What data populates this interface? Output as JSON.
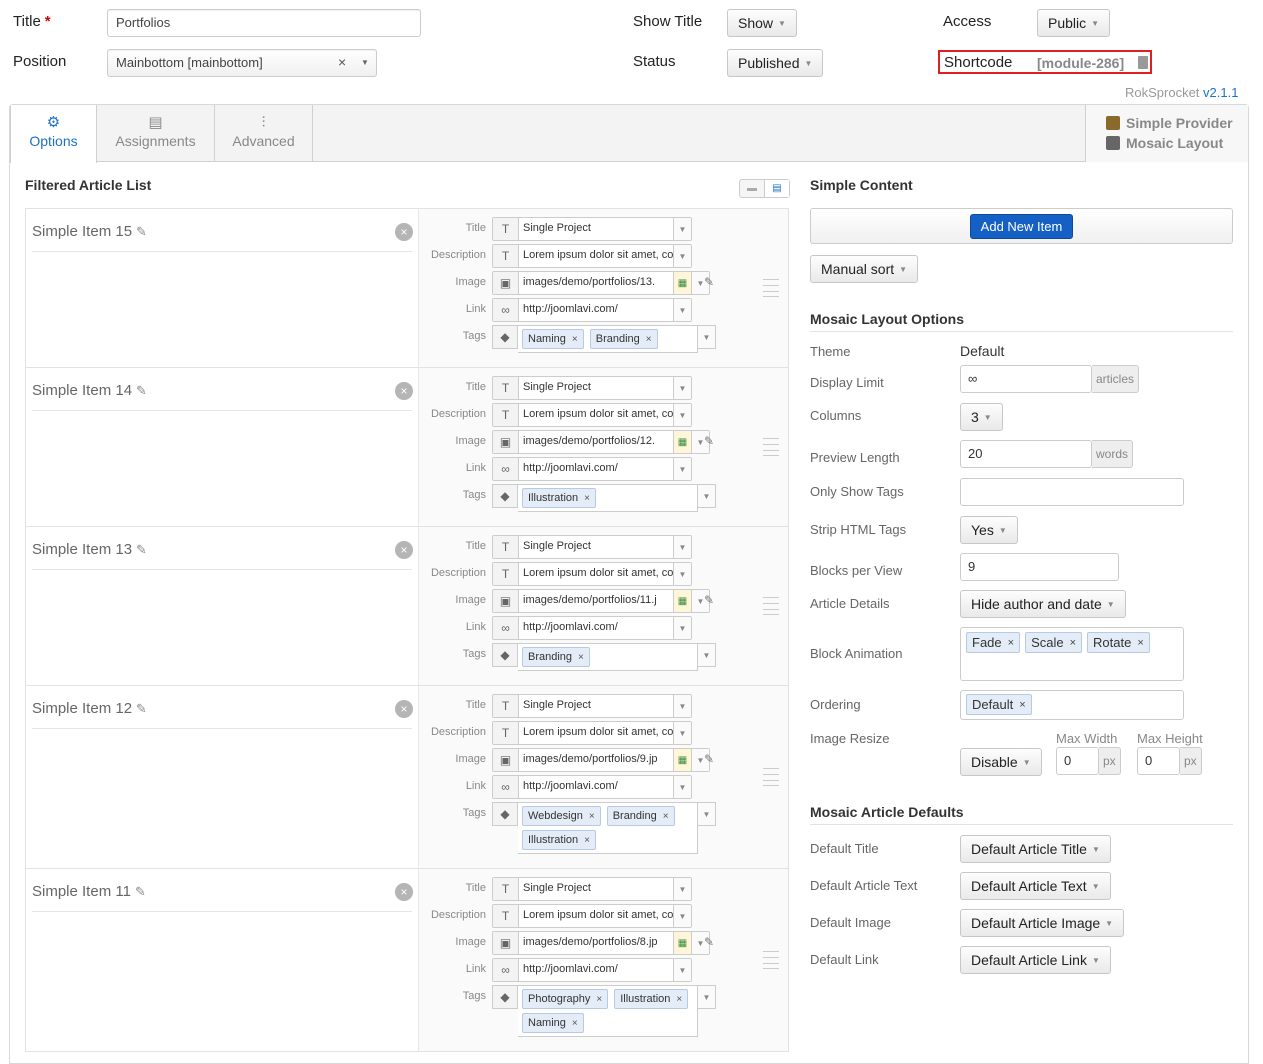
{
  "header": {
    "title_label": "Title",
    "title_required": "*",
    "title_value": "Portfolios",
    "position_label": "Position",
    "position_value": "Mainbottom [mainbottom]",
    "show_title_label": "Show Title",
    "show_title_value": "Show",
    "status_label": "Status",
    "status_value": "Published",
    "access_label": "Access",
    "access_value": "Public",
    "shortcode_label": "Shortcode",
    "shortcode_value": "[module-286]"
  },
  "brand": {
    "name": "RokSprocket",
    "version": "v2.1.1"
  },
  "tabs": [
    {
      "label": "Options",
      "icon": "gear-icon",
      "active": true
    },
    {
      "label": "Assignments",
      "icon": "list-icon",
      "active": false
    },
    {
      "label": "Advanced",
      "icon": "sliders-icon",
      "active": false
    }
  ],
  "provider": {
    "provider_label": "Simple Provider",
    "layout_label": "Mosaic Layout"
  },
  "articles": {
    "section_title": "Filtered Article List",
    "field_labels": {
      "title": "Title",
      "description": "Description",
      "image": "Image",
      "link": "Link",
      "tags": "Tags"
    },
    "items": [
      {
        "name": "Simple Item 15",
        "title": "Single Project",
        "description": "Lorem ipsum dolor sit amet, con",
        "image": "images/demo/portfolios/13.",
        "link": "http://joomlavi.com/",
        "tags": [
          "Naming",
          "Branding"
        ]
      },
      {
        "name": "Simple Item 14",
        "title": "Single Project",
        "description": "Lorem ipsum dolor sit amet, con",
        "image": "images/demo/portfolios/12.",
        "link": "http://joomlavi.com/",
        "tags": [
          "Illustration"
        ]
      },
      {
        "name": "Simple Item 13",
        "title": "Single Project",
        "description": "Lorem ipsum dolor sit amet, con",
        "image": "images/demo/portfolios/11.j",
        "link": "http://joomlavi.com/",
        "tags": [
          "Branding"
        ]
      },
      {
        "name": "Simple Item 12",
        "title": "Single Project",
        "description": "Lorem ipsum dolor sit amet, con",
        "image": "images/demo/portfolios/9.jp",
        "link": "http://joomlavi.com/",
        "tags": [
          "Webdesign",
          "Branding",
          "Illustration"
        ]
      },
      {
        "name": "Simple Item 11",
        "title": "Single Project",
        "description": "Lorem ipsum dolor sit amet, con",
        "image": "images/demo/portfolios/8.jp",
        "link": "http://joomlavi.com/",
        "tags": [
          "Photography",
          "Illustration",
          "Naming"
        ]
      }
    ]
  },
  "simple_content": {
    "section_title": "Simple Content",
    "add_button": "Add New Item",
    "sort_value": "Manual sort"
  },
  "mosaic_options": {
    "section_title": "Mosaic Layout Options",
    "theme_label": "Theme",
    "theme_value": "Default",
    "display_limit_label": "Display Limit",
    "display_limit_value": "∞",
    "display_limit_unit": "articles",
    "columns_label": "Columns",
    "columns_value": "3",
    "preview_length_label": "Preview Length",
    "preview_length_value": "20",
    "preview_length_unit": "words",
    "only_show_tags_label": "Only Show Tags",
    "only_show_tags_value": "",
    "strip_html_label": "Strip HTML Tags",
    "strip_html_value": "Yes",
    "blocks_per_view_label": "Blocks per View",
    "blocks_per_view_value": "9",
    "article_details_label": "Article Details",
    "article_details_value": "Hide author and date",
    "block_animation_label": "Block Animation",
    "block_animation_tags": [
      "Fade",
      "Scale",
      "Rotate"
    ],
    "ordering_label": "Ordering",
    "ordering_tags": [
      "Default"
    ],
    "image_resize_label": "Image Resize",
    "image_resize_value": "Disable",
    "max_width_label": "Max Width",
    "max_width_value": "0",
    "max_height_label": "Max Height",
    "max_height_value": "0",
    "px_unit": "px"
  },
  "mosaic_defaults": {
    "section_title": "Mosaic Article Defaults",
    "default_title_label": "Default Title",
    "default_title_value": "Default Article Title",
    "default_text_label": "Default Article Text",
    "default_text_value": "Default Article Text",
    "default_image_label": "Default Image",
    "default_image_value": "Default Article Image",
    "default_link_label": "Default Link",
    "default_link_value": "Default Article Link"
  },
  "colors": {
    "accent": "#1a72c4",
    "add_button": "#1560c4",
    "shortcode_border": "#e02020",
    "tag_bg": "#e4ecf7"
  }
}
